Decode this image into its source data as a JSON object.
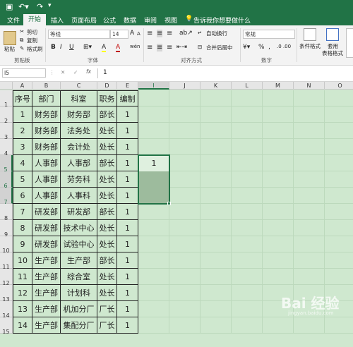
{
  "quick_access": {
    "save_icon": "save-icon",
    "undo_icon": "undo-icon",
    "redo_icon": "redo-icon"
  },
  "tabs": [
    {
      "label": "文件"
    },
    {
      "label": "开始"
    },
    {
      "label": "插入"
    },
    {
      "label": "页面布局"
    },
    {
      "label": "公式"
    },
    {
      "label": "数据"
    },
    {
      "label": "审阅"
    },
    {
      "label": "视图"
    },
    {
      "label": "告诉我你想要做什么"
    }
  ],
  "ribbon": {
    "clipboard": {
      "paste": "粘贴",
      "cut": "剪切",
      "copy": "复制",
      "format_painter": "格式刷",
      "group": "剪贴板"
    },
    "font": {
      "font_name": "等线",
      "font_size": "14",
      "bold": "B",
      "italic": "I",
      "underline": "U",
      "grow": "A",
      "shrink": "A",
      "fill_color": "A",
      "font_color": "A",
      "phonetic": "wén",
      "group": "字体"
    },
    "alignment": {
      "wrap": "自动换行",
      "merge": "合并后居中",
      "group": "对齐方式"
    },
    "number": {
      "format": "常规",
      "percent": "%",
      "comma": ",",
      "group": "数字"
    },
    "styles": {
      "conditional": "条件格式",
      "table_1": "套用",
      "table_2": "表格格式"
    }
  },
  "formula_bar": {
    "name_box": "I5",
    "cancel": "✕",
    "enter": "✓",
    "fx": "fx",
    "value": "1"
  },
  "columns": [
    "A",
    "B",
    "C",
    "D",
    "E",
    "I",
    "J",
    "K",
    "L",
    "M",
    "N",
    "O"
  ],
  "table": {
    "headers": [
      "序号",
      "部门",
      "科室",
      "职务",
      "编制"
    ],
    "rows": [
      [
        "1",
        "财务部",
        "财务部",
        "部长",
        "1"
      ],
      [
        "2",
        "财务部",
        "法务处",
        "处长",
        "1"
      ],
      [
        "3",
        "财务部",
        "会计处",
        "处长",
        "1"
      ],
      [
        "4",
        "人事部",
        "人事部",
        "部长",
        "1"
      ],
      [
        "5",
        "人事部",
        "劳务科",
        "处长",
        "1"
      ],
      [
        "6",
        "人事部",
        "人事科",
        "处长",
        "1"
      ],
      [
        "7",
        "研发部",
        "研发部",
        "部长",
        "1"
      ],
      [
        "8",
        "研发部",
        "技术中心",
        "处长",
        "1"
      ],
      [
        "9",
        "研发部",
        "试验中心",
        "处长",
        "1"
      ],
      [
        "10",
        "生产部",
        "生产部",
        "部长",
        "1"
      ],
      [
        "11",
        "生产部",
        "综合室",
        "处长",
        "1"
      ],
      [
        "12",
        "生产部",
        "计划科",
        "处长",
        "1"
      ],
      [
        "13",
        "生产部",
        "机加分厂",
        "厂长",
        "1"
      ],
      [
        "14",
        "生产部",
        "集配分厂",
        "厂长",
        "1"
      ]
    ]
  },
  "row_numbers": [
    "1",
    "2",
    "3",
    "4",
    "5",
    "6",
    "7",
    "8",
    "9",
    "10",
    "11",
    "12",
    "13",
    "14",
    "15"
  ],
  "selection": {
    "cell_value": "1"
  },
  "watermark": {
    "text": "Bai 经验",
    "sub": "jingyan.baidu.com"
  }
}
